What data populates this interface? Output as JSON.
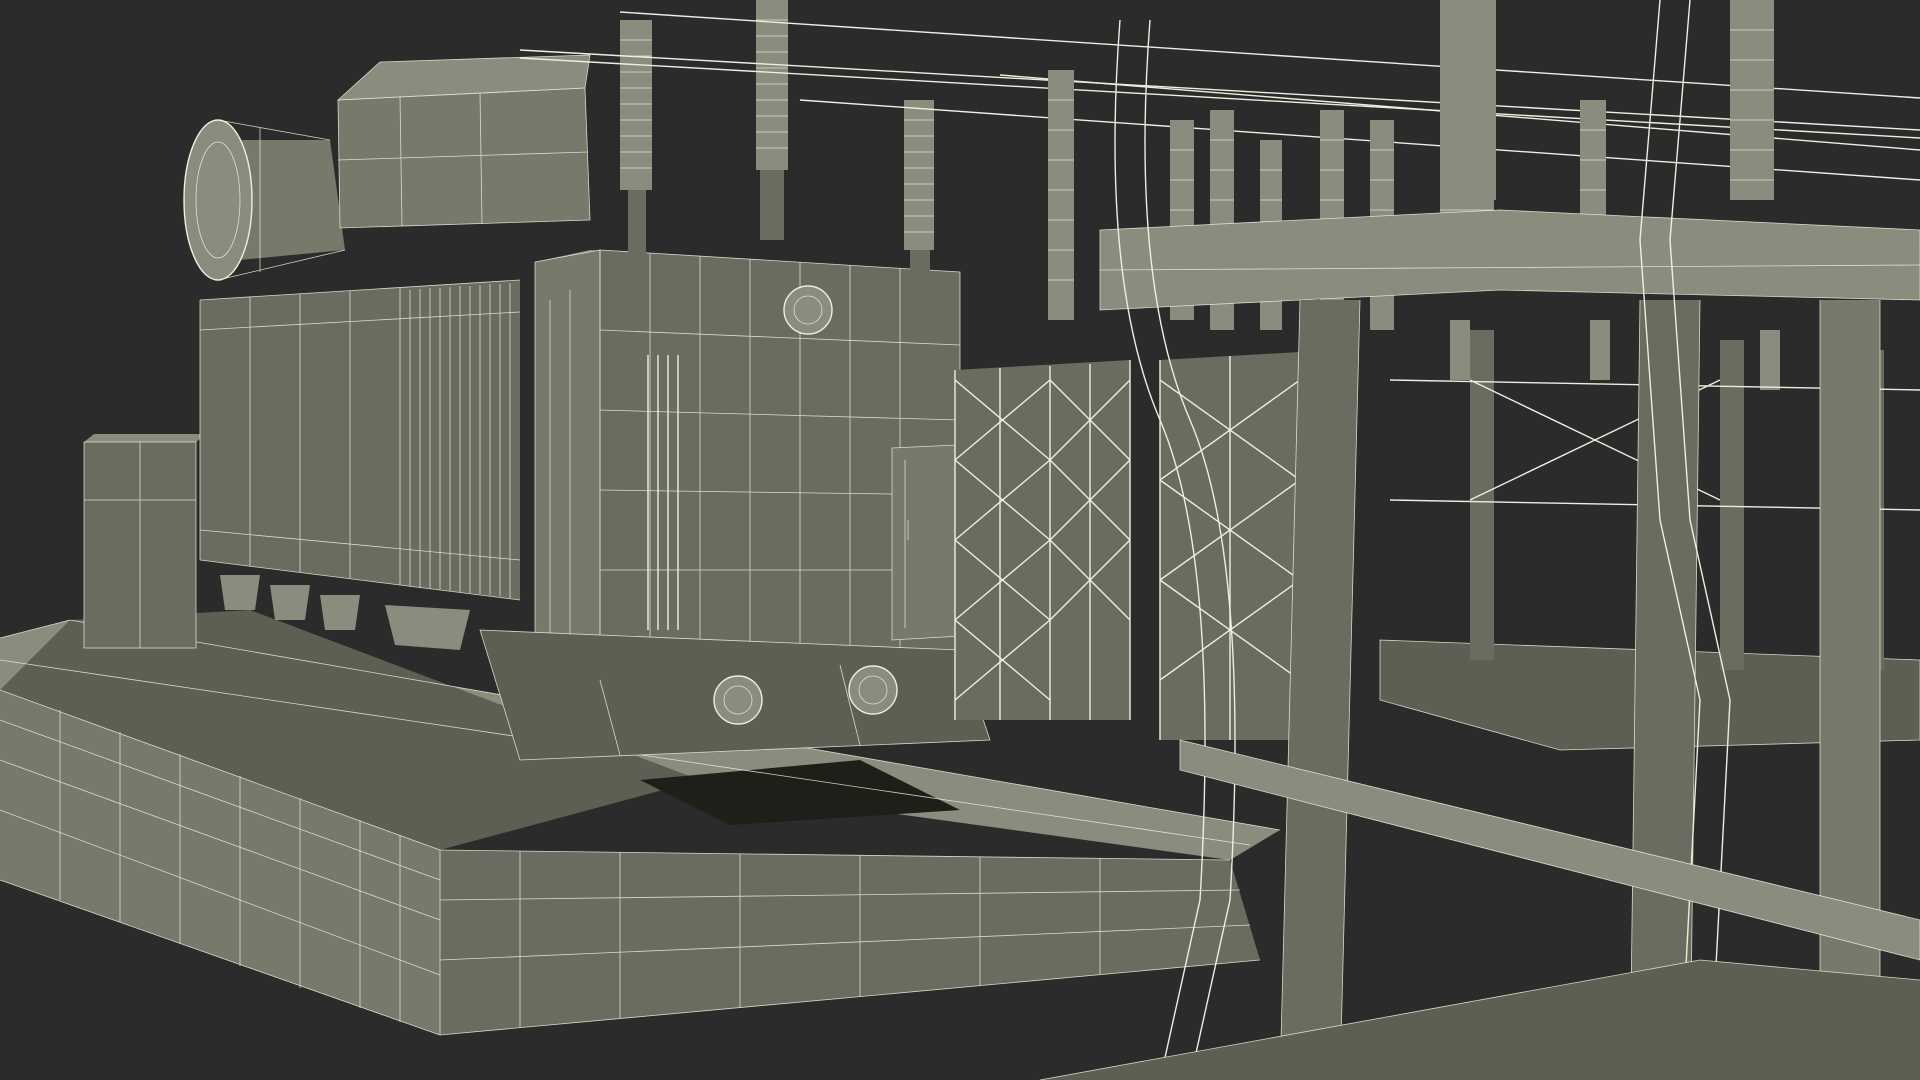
{
  "scene": {
    "background": "#2b2b2b",
    "wire_color": "#efeede",
    "surface_color": "#77796b",
    "render_style": "wireframe",
    "subject": "electrical-substation-transformer"
  },
  "counts": {
    "insulator_columns": 14,
    "cooling_radiators": 4,
    "support_frames": 2
  }
}
